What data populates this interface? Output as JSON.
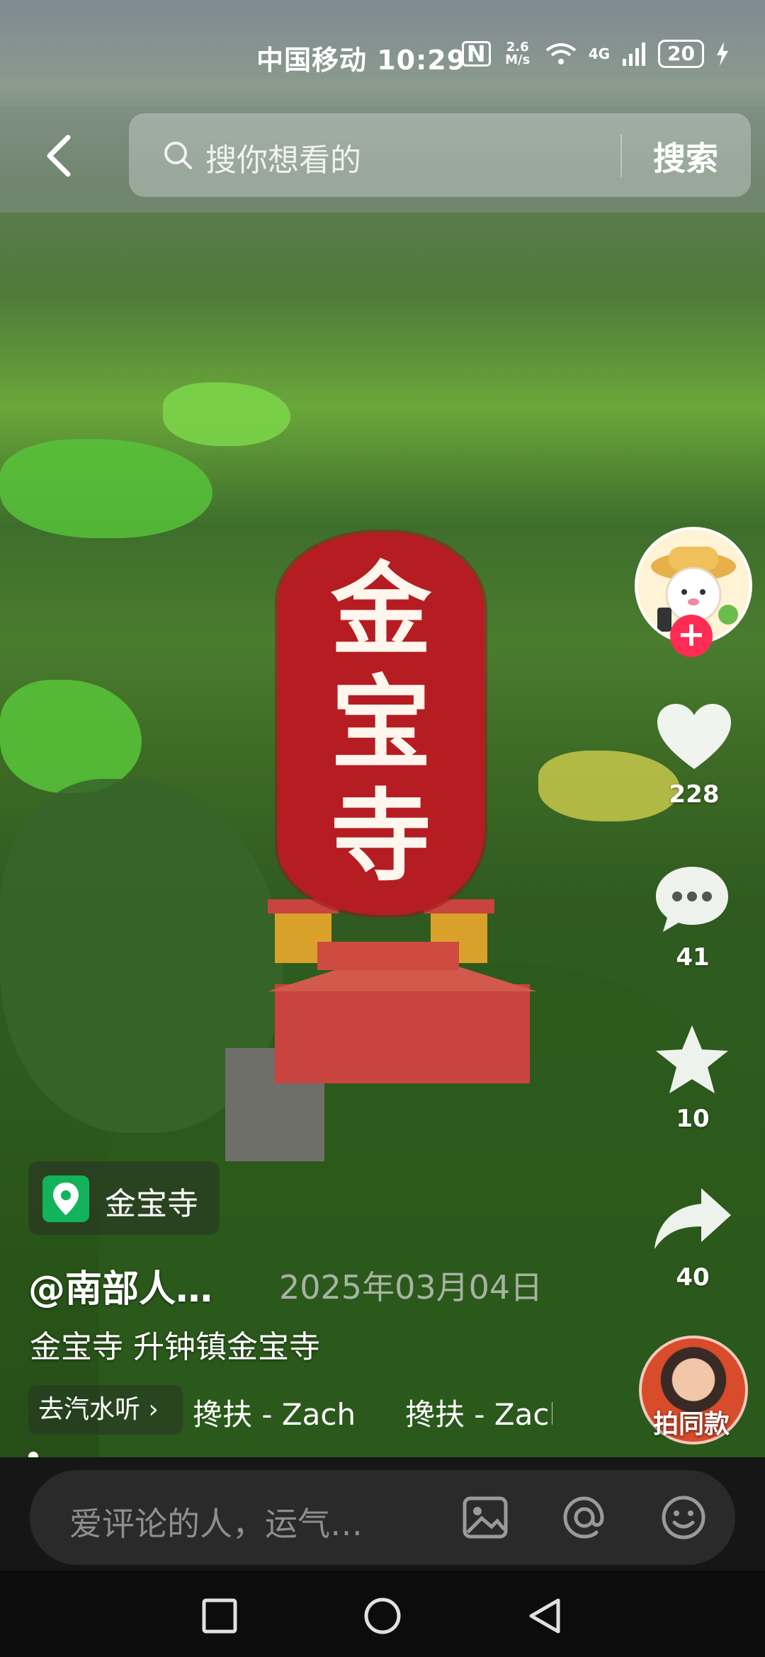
{
  "status_bar": {
    "carrier_time": "中国移动 10:29",
    "nfc": "N",
    "net_speed": "2.6 M/s",
    "network": "4G",
    "battery": "20"
  },
  "search": {
    "placeholder": "搜你想看的",
    "button_label": "搜索"
  },
  "video": {
    "overlay_title": [
      "金",
      "宝",
      "寺"
    ]
  },
  "actions": {
    "like_count": "228",
    "comment_count": "41",
    "favorite_count": "10",
    "share_count": "40",
    "remix_label": "拍同款",
    "follow_symbol": "+"
  },
  "post": {
    "location": "金宝寺",
    "author": "@南部人…",
    "date": "2025年03月04日",
    "caption": "金宝寺 升钟镇金宝寺",
    "music_chip": "去汽水听 ›",
    "music_title_1": "搀扶 - Zach",
    "music_title_2": "搀扶 - Zach"
  },
  "comment": {
    "placeholder": "爱评论的人，运气…"
  },
  "colors": {
    "seal_red": "#b51d22",
    "follow_pink": "#fe2c55",
    "location_green": "#12b35a"
  }
}
